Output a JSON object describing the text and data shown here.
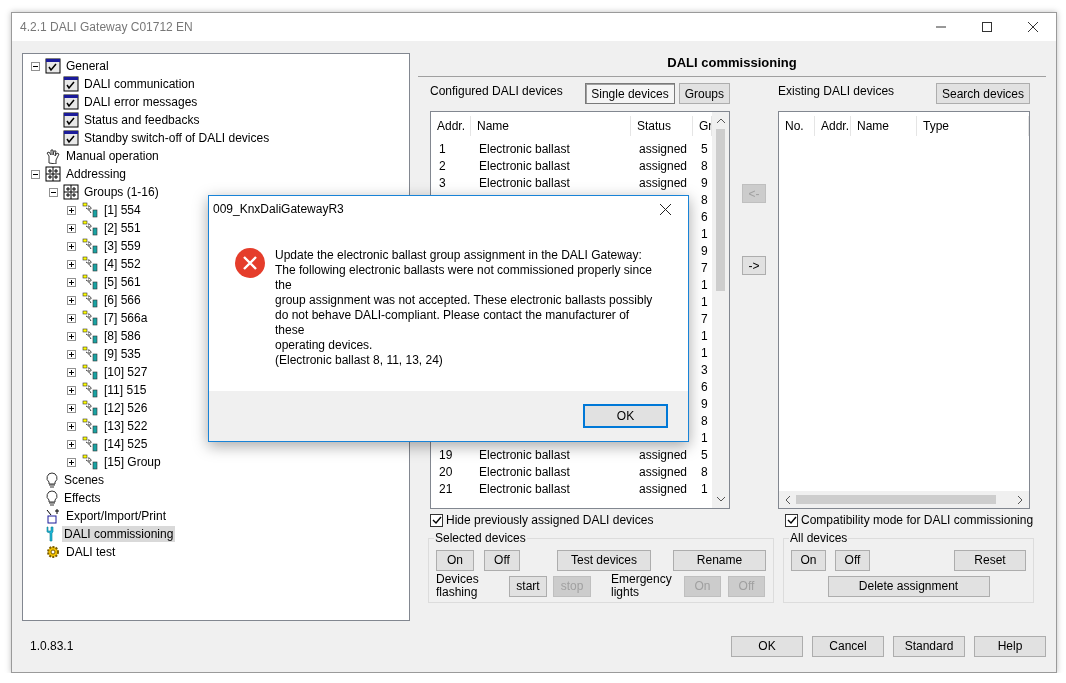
{
  "window": {
    "title": "4.2.1 DALI Gateway C01712 EN"
  },
  "tree": [
    {
      "label": "General",
      "kind": "checklist",
      "expanded": true,
      "selected": false,
      "children": [
        {
          "label": "DALI communication",
          "kind": "checklist",
          "selected": false
        },
        {
          "label": "DALI error messages",
          "kind": "checklist",
          "selected": false
        },
        {
          "label": "Status and feedbacks",
          "kind": "checklist",
          "selected": false
        },
        {
          "label": "Standby switch-off of DALI devices",
          "kind": "checklist",
          "selected": false
        }
      ]
    },
    {
      "label": "Manual operation",
      "kind": "hand",
      "selected": false
    },
    {
      "label": "Addressing",
      "kind": "grid",
      "expanded": true,
      "selected": false,
      "children": [
        {
          "label": "Groups (1-16)",
          "kind": "grid",
          "expanded": true,
          "selected": false,
          "children": [
            {
              "label": "[1] 554",
              "kind": "group",
              "expanded": false,
              "selected": false
            },
            {
              "label": "[2] 551",
              "kind": "group",
              "expanded": false,
              "selected": false
            },
            {
              "label": "[3] 559",
              "kind": "group",
              "expanded": false,
              "selected": false
            },
            {
              "label": "[4] 552",
              "kind": "group",
              "expanded": false,
              "selected": false
            },
            {
              "label": "[5] 561",
              "kind": "group",
              "expanded": false,
              "selected": false
            },
            {
              "label": "[6] 566",
              "kind": "group",
              "expanded": false,
              "selected": false
            },
            {
              "label": "[7] 566a",
              "kind": "group",
              "expanded": false,
              "selected": false
            },
            {
              "label": "[8] 586",
              "kind": "group",
              "expanded": false,
              "selected": false
            },
            {
              "label": "[9] 535",
              "kind": "group",
              "expanded": false,
              "selected": false
            },
            {
              "label": "[10] 527",
              "kind": "group",
              "expanded": false,
              "selected": false
            },
            {
              "label": "[11] 515",
              "kind": "group",
              "expanded": false,
              "selected": false
            },
            {
              "label": "[12] 526",
              "kind": "group",
              "expanded": false,
              "selected": false
            },
            {
              "label": "[13] 522",
              "kind": "group",
              "expanded": false,
              "selected": false
            },
            {
              "label": "[14] 525",
              "kind": "group",
              "expanded": false,
              "selected": false
            },
            {
              "label": "[15] Group",
              "kind": "group",
              "expanded": false,
              "selected": false
            }
          ]
        }
      ]
    },
    {
      "label": "Scenes",
      "kind": "bulb",
      "selected": false
    },
    {
      "label": "Effects",
      "kind": "bulb",
      "selected": false
    },
    {
      "label": "Export/Import/Print",
      "kind": "export",
      "selected": false
    },
    {
      "label": "DALI commissioning",
      "kind": "wrench",
      "selected": true
    },
    {
      "label": "DALI test",
      "kind": "gear",
      "selected": false
    }
  ],
  "page": {
    "title": "DALI commissioning"
  },
  "configured": {
    "title": "Configured DALI devices",
    "view_buttons": [
      {
        "label": "Single devices",
        "selected": true
      },
      {
        "label": "Groups",
        "selected": false
      }
    ],
    "columns": [
      "Addr.",
      "Name",
      "Status",
      "Gr"
    ],
    "rows": [
      {
        "addr": "1",
        "name": "Electronic ballast",
        "status": "assigned",
        "group": "5"
      },
      {
        "addr": "2",
        "name": "Electronic ballast",
        "status": "assigned",
        "group": "8"
      },
      {
        "addr": "3",
        "name": "Electronic ballast",
        "status": "assigned",
        "group": "9"
      },
      {
        "group": "8"
      },
      {
        "group": "6"
      },
      {
        "group": "1"
      },
      {
        "group": "9"
      },
      {
        "group": "7"
      },
      {
        "group": "1"
      },
      {
        "group": "1"
      },
      {
        "group": "7"
      },
      {
        "group": "1"
      },
      {
        "group": "1"
      },
      {
        "group": "3"
      },
      {
        "group": "6"
      },
      {
        "group": "9"
      },
      {
        "group": "8"
      },
      {
        "group": "1"
      },
      {
        "addr": "19",
        "name": "Electronic ballast",
        "status": "assigned",
        "group": "5"
      },
      {
        "addr": "20",
        "name": "Electronic ballast",
        "status": "assigned",
        "group": "8"
      },
      {
        "addr": "21",
        "name": "Electronic ballast",
        "status": "assigned",
        "group": "1"
      }
    ]
  },
  "transfer_buttons": [
    {
      "label": "<-",
      "disabled": true
    },
    {
      "label": "->",
      "disabled": false
    }
  ],
  "existing": {
    "title": "Existing DALI devices",
    "search_button": "Search devices",
    "columns": [
      "No.",
      "Addr.",
      "Name",
      "Type"
    ]
  },
  "hide_assigned": {
    "label": "Hide previously assigned DALI devices",
    "checked": true
  },
  "compatibility_mode": {
    "label": "Compatibility mode for DALI commissioning",
    "checked": true
  },
  "selected_devices": {
    "title": "Selected devices",
    "buttons": [
      {
        "label": "On",
        "disabled": false
      },
      {
        "label": "Off",
        "disabled": false
      },
      {
        "label": "Test devices",
        "disabled": false
      },
      {
        "label": "Rename",
        "disabled": false
      }
    ],
    "flashing": {
      "label": "Devices\nflashing",
      "buttons": [
        {
          "label": "start",
          "disabled": false
        },
        {
          "label": "stop",
          "disabled": true
        }
      ]
    },
    "emergency": {
      "label": "Emergency\nlights",
      "buttons": [
        {
          "label": "On",
          "disabled": true
        },
        {
          "label": "Off",
          "disabled": true
        }
      ]
    }
  },
  "all_devices": {
    "title": "All devices",
    "buttons": [
      {
        "label": "On",
        "disabled": false
      },
      {
        "label": "Off",
        "disabled": false
      },
      {
        "label": "Reset",
        "disabled": false
      }
    ],
    "delete_button": "Delete assignment"
  },
  "footer": {
    "version": "1.0.83.1",
    "buttons": [
      "OK",
      "Cancel",
      "Standard",
      "Help"
    ]
  },
  "dialog": {
    "title": "009_KnxDaliGatewayR3",
    "message": "Update the electronic ballast group assignment in the DALI Gateway:\nThe following electronic ballasts were not commissioned properly since\nthe\ngroup assignment was not accepted. These electronic ballasts possibly\ndo not behave DALI-compliant. Please contact the manufacturer of\nthese\noperating devices.\n(Electronic ballast 8, 11, 13, 24)",
    "button": "OK"
  }
}
